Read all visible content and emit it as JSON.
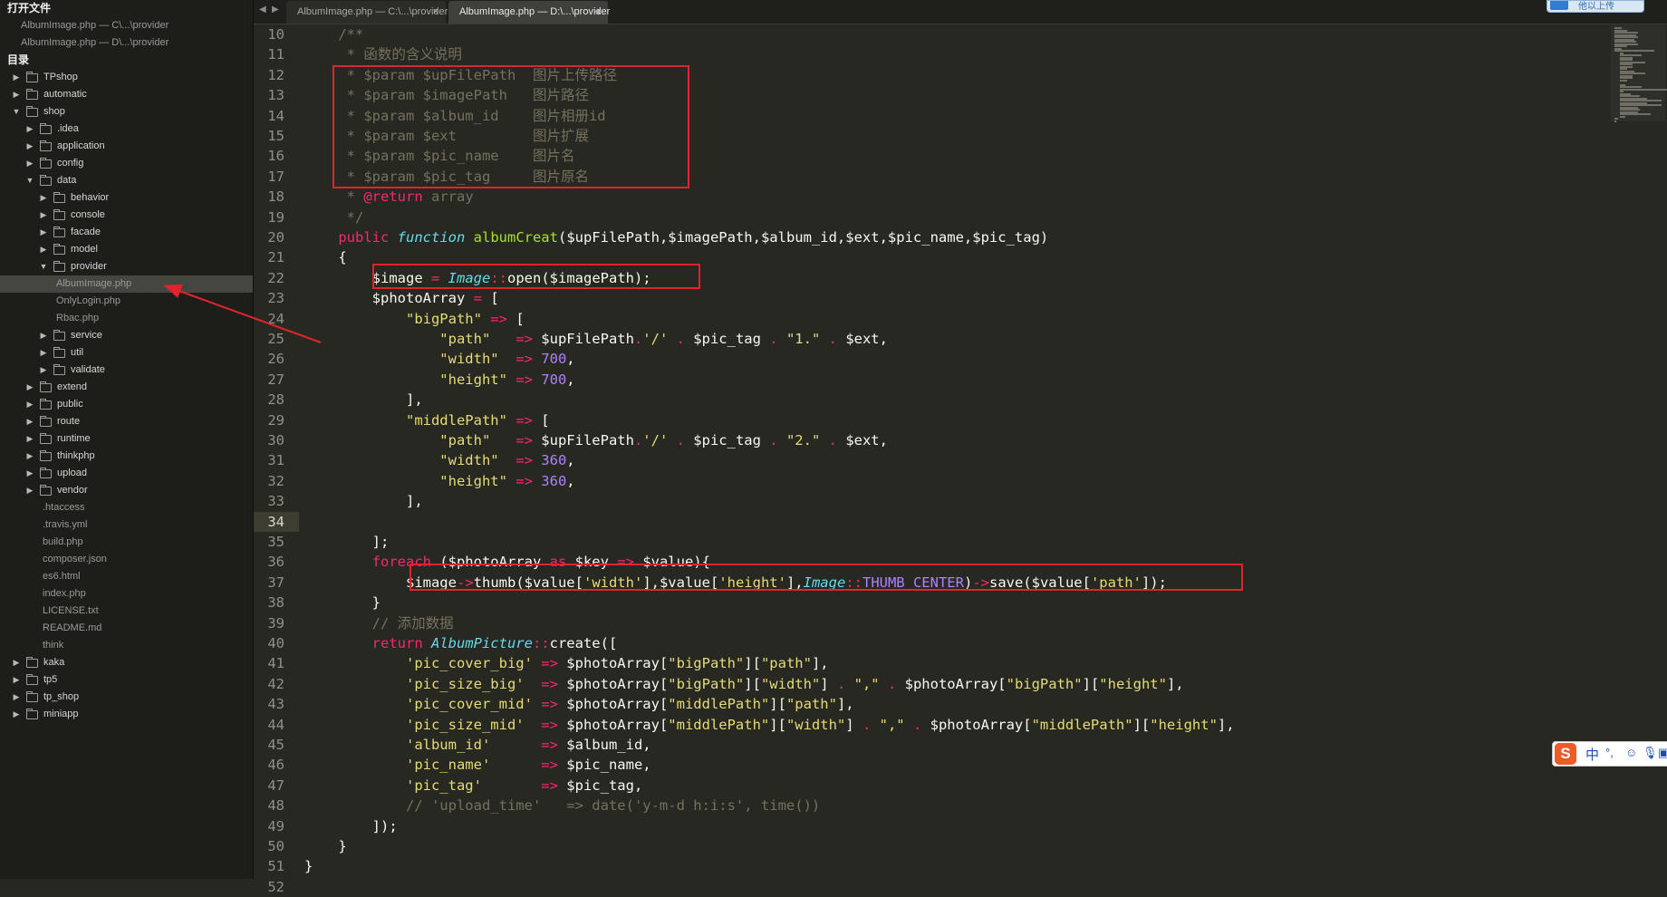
{
  "sidebar": {
    "open_files_title": "打开文件",
    "open_files": [
      "AlbumImage.php — C\\...\\provider",
      "AlbumImage.php — D\\...\\provider"
    ],
    "directory_title": "目录",
    "tree": [
      {
        "label": "TPshop",
        "type": "folder",
        "level": 0,
        "expanded": false
      },
      {
        "label": "automatic",
        "type": "folder",
        "level": 0,
        "expanded": false
      },
      {
        "label": "shop",
        "type": "folder",
        "level": 0,
        "expanded": true
      },
      {
        "label": ".idea",
        "type": "folder",
        "level": 1,
        "expanded": false
      },
      {
        "label": "application",
        "type": "folder",
        "level": 1,
        "expanded": false
      },
      {
        "label": "config",
        "type": "folder",
        "level": 1,
        "expanded": false
      },
      {
        "label": "data",
        "type": "folder",
        "level": 1,
        "expanded": true
      },
      {
        "label": "behavior",
        "type": "folder",
        "level": 2,
        "expanded": false
      },
      {
        "label": "console",
        "type": "folder",
        "level": 2,
        "expanded": false
      },
      {
        "label": "facade",
        "type": "folder",
        "level": 2,
        "expanded": false
      },
      {
        "label": "model",
        "type": "folder",
        "level": 2,
        "expanded": false
      },
      {
        "label": "provider",
        "type": "folder",
        "level": 2,
        "expanded": true
      },
      {
        "label": "AlbumImage.php",
        "type": "file",
        "level": 3,
        "selected": true
      },
      {
        "label": "OnlyLogin.php",
        "type": "file",
        "level": 3
      },
      {
        "label": "Rbac.php",
        "type": "file",
        "level": 3
      },
      {
        "label": "service",
        "type": "folder",
        "level": 2,
        "expanded": false
      },
      {
        "label": "util",
        "type": "folder",
        "level": 2,
        "expanded": false
      },
      {
        "label": "validate",
        "type": "folder",
        "level": 2,
        "expanded": false
      },
      {
        "label": "extend",
        "type": "folder",
        "level": 1,
        "expanded": false
      },
      {
        "label": "public",
        "type": "folder",
        "level": 1,
        "expanded": false
      },
      {
        "label": "route",
        "type": "folder",
        "level": 1,
        "expanded": false
      },
      {
        "label": "runtime",
        "type": "folder",
        "level": 1,
        "expanded": false
      },
      {
        "label": "thinkphp",
        "type": "folder",
        "level": 1,
        "expanded": false
      },
      {
        "label": "upload",
        "type": "folder",
        "level": 1,
        "expanded": false
      },
      {
        "label": "vendor",
        "type": "folder",
        "level": 1,
        "expanded": false
      },
      {
        "label": ".htaccess",
        "type": "file",
        "level": 2
      },
      {
        "label": ".travis.yml",
        "type": "file",
        "level": 2
      },
      {
        "label": "build.php",
        "type": "file",
        "level": 2
      },
      {
        "label": "composer.json",
        "type": "file",
        "level": 2
      },
      {
        "label": "es6.html",
        "type": "file",
        "level": 2
      },
      {
        "label": "index.php",
        "type": "file",
        "level": 2
      },
      {
        "label": "LICENSE.txt",
        "type": "file",
        "level": 2
      },
      {
        "label": "README.md",
        "type": "file",
        "level": 2
      },
      {
        "label": "think",
        "type": "file",
        "level": 2
      },
      {
        "label": "kaka",
        "type": "folder",
        "level": 0,
        "expanded": false
      },
      {
        "label": "tp5",
        "type": "folder",
        "level": 0,
        "expanded": false
      },
      {
        "label": "tp_shop",
        "type": "folder",
        "level": 0,
        "expanded": false
      },
      {
        "label": "miniapp",
        "type": "folder",
        "level": 0,
        "expanded": false
      }
    ]
  },
  "tabs": [
    {
      "label": "AlbumImage.php — C:\\...\\provider",
      "active": false,
      "close": "×"
    },
    {
      "label": "AlbumImage.php — D:\\...\\provider",
      "active": true,
      "close": "●"
    }
  ],
  "tab_nav": {
    "prev": "◀",
    "next": "▶"
  },
  "editor": {
    "current_line": 34,
    "lines": [
      {
        "n": "10",
        "t": [
          [
            "c",
            "    /**"
          ]
        ]
      },
      {
        "n": "11",
        "t": [
          [
            "c",
            "     * 函数的含义说明"
          ]
        ]
      },
      {
        "n": "12",
        "t": [
          [
            "c",
            "     * $param $upFilePath  图片上传路径"
          ]
        ]
      },
      {
        "n": "13",
        "t": [
          [
            "c",
            "     * $param $imagePath   图片路径"
          ]
        ]
      },
      {
        "n": "14",
        "t": [
          [
            "c",
            "     * $param $album_id    图片相册id"
          ]
        ]
      },
      {
        "n": "15",
        "t": [
          [
            "c",
            "     * $param $ext         图片扩展"
          ]
        ]
      },
      {
        "n": "16",
        "t": [
          [
            "c",
            "     * $param $pic_name    图片名"
          ]
        ]
      },
      {
        "n": "17",
        "t": [
          [
            "c",
            "     * $param $pic_tag     图片原名"
          ]
        ]
      },
      {
        "n": "18",
        "t": [
          [
            "c",
            "     * "
          ],
          [
            "k",
            "@return"
          ],
          [
            "c",
            " array"
          ]
        ]
      },
      {
        "n": "19",
        "t": [
          [
            "c",
            "     */"
          ]
        ]
      },
      {
        "n": "20",
        "t": [
          [
            "k",
            "    public "
          ],
          [
            "st",
            "function "
          ],
          [
            "f",
            "albumCreat"
          ],
          [
            "p",
            "($upFilePath,$imagePath,$album_id,$ext,$pic_name,$pic_tag)"
          ]
        ]
      },
      {
        "n": "21",
        "t": [
          [
            "p",
            "    {"
          ]
        ]
      },
      {
        "n": "22",
        "t": [
          [
            "p",
            "        $image "
          ],
          [
            "k",
            "= "
          ],
          [
            "st",
            "Image"
          ],
          [
            "k",
            "::"
          ],
          [
            "p",
            "open($imagePath);"
          ]
        ]
      },
      {
        "n": "23",
        "t": [
          [
            "p",
            "        $photoArray "
          ],
          [
            "k",
            "= "
          ],
          [
            "p",
            "["
          ]
        ]
      },
      {
        "n": "24",
        "t": [
          [
            "s",
            "            \"bigPath\" "
          ],
          [
            "k",
            "=> "
          ],
          [
            "p",
            "["
          ]
        ]
      },
      {
        "n": "25",
        "t": [
          [
            "s",
            "                \"path\"   "
          ],
          [
            "k",
            "=> "
          ],
          [
            "p",
            "$upFilePath"
          ],
          [
            "k",
            "."
          ],
          [
            "s",
            "'/' "
          ],
          [
            "k",
            ". "
          ],
          [
            "p",
            "$pic_tag "
          ],
          [
            "k",
            ". "
          ],
          [
            "s",
            "\"1.\" "
          ],
          [
            "k",
            ". "
          ],
          [
            "p",
            "$ext,"
          ]
        ]
      },
      {
        "n": "26",
        "t": [
          [
            "s",
            "                \"width\"  "
          ],
          [
            "k",
            "=> "
          ],
          [
            "n",
            "700"
          ],
          [
            "p",
            ","
          ]
        ]
      },
      {
        "n": "27",
        "t": [
          [
            "s",
            "                \"height\" "
          ],
          [
            "k",
            "=> "
          ],
          [
            "n",
            "700"
          ],
          [
            "p",
            ","
          ]
        ]
      },
      {
        "n": "28",
        "t": [
          [
            "p",
            "            ],"
          ]
        ]
      },
      {
        "n": "29",
        "t": [
          [
            "s",
            "            \"middlePath\" "
          ],
          [
            "k",
            "=> "
          ],
          [
            "p",
            "["
          ]
        ]
      },
      {
        "n": "30",
        "t": [
          [
            "s",
            "                \"path\"   "
          ],
          [
            "k",
            "=> "
          ],
          [
            "p",
            "$upFilePath"
          ],
          [
            "k",
            "."
          ],
          [
            "s",
            "'/' "
          ],
          [
            "k",
            ". "
          ],
          [
            "p",
            "$pic_tag "
          ],
          [
            "k",
            ". "
          ],
          [
            "s",
            "\"2.\" "
          ],
          [
            "k",
            ". "
          ],
          [
            "p",
            "$ext,"
          ]
        ]
      },
      {
        "n": "31",
        "t": [
          [
            "s",
            "                \"width\"  "
          ],
          [
            "k",
            "=> "
          ],
          [
            "n",
            "360"
          ],
          [
            "p",
            ","
          ]
        ]
      },
      {
        "n": "32",
        "t": [
          [
            "s",
            "                \"height\" "
          ],
          [
            "k",
            "=> "
          ],
          [
            "n",
            "360"
          ],
          [
            "p",
            ","
          ]
        ]
      },
      {
        "n": "33",
        "t": [
          [
            "p",
            "            ],"
          ]
        ]
      },
      {
        "n": "34",
        "t": [
          [
            "p",
            ""
          ]
        ]
      },
      {
        "n": "35",
        "t": [
          [
            "p",
            "        ];"
          ]
        ]
      },
      {
        "n": "36",
        "t": [
          [
            "k",
            "        foreach "
          ],
          [
            "p",
            "($photoArray "
          ],
          [
            "k",
            "as "
          ],
          [
            "p",
            "$key "
          ],
          [
            "k",
            "=> "
          ],
          [
            "p",
            "$value){"
          ]
        ]
      },
      {
        "n": "37",
        "t": [
          [
            "p",
            "            $image"
          ],
          [
            "k",
            "->"
          ],
          [
            "p",
            "thumb($value["
          ],
          [
            "s",
            "'width'"
          ],
          [
            "p",
            "],$value["
          ],
          [
            "s",
            "'height'"
          ],
          [
            "p",
            "],"
          ],
          [
            "st",
            "Image"
          ],
          [
            "k",
            "::"
          ],
          [
            "n",
            "THUMB_CENTER"
          ],
          [
            "p",
            ")"
          ],
          [
            "k",
            "->"
          ],
          [
            "p",
            "save($value["
          ],
          [
            "s",
            "'path'"
          ],
          [
            "p",
            "]);"
          ]
        ]
      },
      {
        "n": "38",
        "t": [
          [
            "p",
            "        }"
          ]
        ]
      },
      {
        "n": "39",
        "t": [
          [
            "c",
            "        // 添加数据"
          ]
        ]
      },
      {
        "n": "40",
        "t": [
          [
            "k",
            "        return "
          ],
          [
            "st",
            "AlbumPicture"
          ],
          [
            "k",
            "::"
          ],
          [
            "p",
            "create(["
          ]
        ]
      },
      {
        "n": "41",
        "t": [
          [
            "s",
            "            'pic_cover_big' "
          ],
          [
            "k",
            "=> "
          ],
          [
            "p",
            "$photoArray["
          ],
          [
            "s",
            "\"bigPath\""
          ],
          [
            "p",
            "]["
          ],
          [
            "s",
            "\"path\""
          ],
          [
            "p",
            "],"
          ]
        ]
      },
      {
        "n": "42",
        "t": [
          [
            "s",
            "            'pic_size_big'  "
          ],
          [
            "k",
            "=> "
          ],
          [
            "p",
            "$photoArray["
          ],
          [
            "s",
            "\"bigPath\""
          ],
          [
            "p",
            "]["
          ],
          [
            "s",
            "\"width\""
          ],
          [
            "p",
            "] "
          ],
          [
            "k",
            ". "
          ],
          [
            "s",
            "\",\" "
          ],
          [
            "k",
            ". "
          ],
          [
            "p",
            "$photoArray["
          ],
          [
            "s",
            "\"bigPath\""
          ],
          [
            "p",
            "]["
          ],
          [
            "s",
            "\"height\""
          ],
          [
            "p",
            "],"
          ]
        ]
      },
      {
        "n": "43",
        "t": [
          [
            "s",
            "            'pic_cover_mid' "
          ],
          [
            "k",
            "=> "
          ],
          [
            "p",
            "$photoArray["
          ],
          [
            "s",
            "\"middlePath\""
          ],
          [
            "p",
            "]["
          ],
          [
            "s",
            "\"path\""
          ],
          [
            "p",
            "],"
          ]
        ]
      },
      {
        "n": "44",
        "t": [
          [
            "s",
            "            'pic_size_mid'  "
          ],
          [
            "k",
            "=> "
          ],
          [
            "p",
            "$photoArray["
          ],
          [
            "s",
            "\"middlePath\""
          ],
          [
            "p",
            "]["
          ],
          [
            "s",
            "\"width\""
          ],
          [
            "p",
            "] "
          ],
          [
            "k",
            ". "
          ],
          [
            "s",
            "\",\" "
          ],
          [
            "k",
            ". "
          ],
          [
            "p",
            "$photoArray["
          ],
          [
            "s",
            "\"middlePath\""
          ],
          [
            "p",
            "]["
          ],
          [
            "s",
            "\"height\""
          ],
          [
            "p",
            "],"
          ]
        ]
      },
      {
        "n": "45",
        "t": [
          [
            "s",
            "            'album_id'      "
          ],
          [
            "k",
            "=> "
          ],
          [
            "p",
            "$album_id,"
          ]
        ]
      },
      {
        "n": "46",
        "t": [
          [
            "s",
            "            'pic_name'      "
          ],
          [
            "k",
            "=> "
          ],
          [
            "p",
            "$pic_name,"
          ]
        ]
      },
      {
        "n": "47",
        "t": [
          [
            "s",
            "            'pic_tag'       "
          ],
          [
            "k",
            "=> "
          ],
          [
            "p",
            "$pic_tag,"
          ]
        ]
      },
      {
        "n": "48",
        "t": [
          [
            "c",
            "            // 'upload_time'   => date('y-m-d h:i:s', time())"
          ]
        ]
      },
      {
        "n": "49",
        "t": [
          [
            "p",
            "        ]);"
          ]
        ]
      },
      {
        "n": "50",
        "t": [
          [
            "p",
            "    }"
          ]
        ]
      },
      {
        "n": "51",
        "t": [
          [
            "p",
            "}"
          ]
        ]
      },
      {
        "n": "52",
        "t": [
          [
            "p",
            ""
          ]
        ]
      }
    ]
  },
  "ime": {
    "logo": "S",
    "lang": "中",
    "glyphs": [
      "°,",
      "☺",
      "🎙",
      "▣"
    ]
  },
  "cloud_button": {
    "label": "他以上传"
  },
  "colors": {
    "annotation_red": "#e0242b",
    "editor_bg": "#272822",
    "sidebar_bg": "#1d1e19"
  }
}
